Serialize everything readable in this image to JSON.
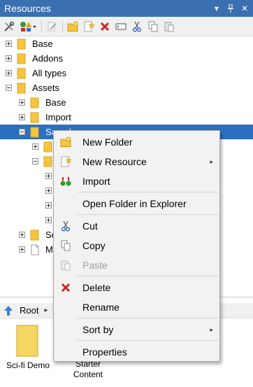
{
  "window": {
    "title": "Resources"
  },
  "tree": {
    "rows": [
      {
        "label": "Base"
      },
      {
        "label": "Addons"
      },
      {
        "label": "All types"
      },
      {
        "label": "Assets"
      },
      {
        "label": "Base"
      },
      {
        "label": "Import"
      },
      {
        "label": "Samples"
      },
      {
        "label": "So"
      },
      {
        "label": "My"
      }
    ]
  },
  "breadcrumb": {
    "root": "Root"
  },
  "tiles": [
    {
      "label": "Sci-fi Demo"
    },
    {
      "label_line1": "Starter",
      "label_line2": "Content"
    }
  ],
  "context_menu": {
    "items": [
      {
        "label": "New Folder"
      },
      {
        "label": "New Resource",
        "submenu": "▸"
      },
      {
        "label": "Import"
      },
      {
        "label": "Open Folder in Explorer"
      },
      {
        "label": "Cut"
      },
      {
        "label": "Copy"
      },
      {
        "label": "Paste",
        "disabled": true
      },
      {
        "label": "Delete"
      },
      {
        "label": "Rename"
      },
      {
        "label": "Sort by",
        "submenu": "▸"
      },
      {
        "label": "Properties"
      }
    ]
  },
  "colors": {
    "titlebar": "#3a6fb0",
    "selection": "#2b6fc1",
    "folder": "#f5c542",
    "delete": "#d42020"
  }
}
